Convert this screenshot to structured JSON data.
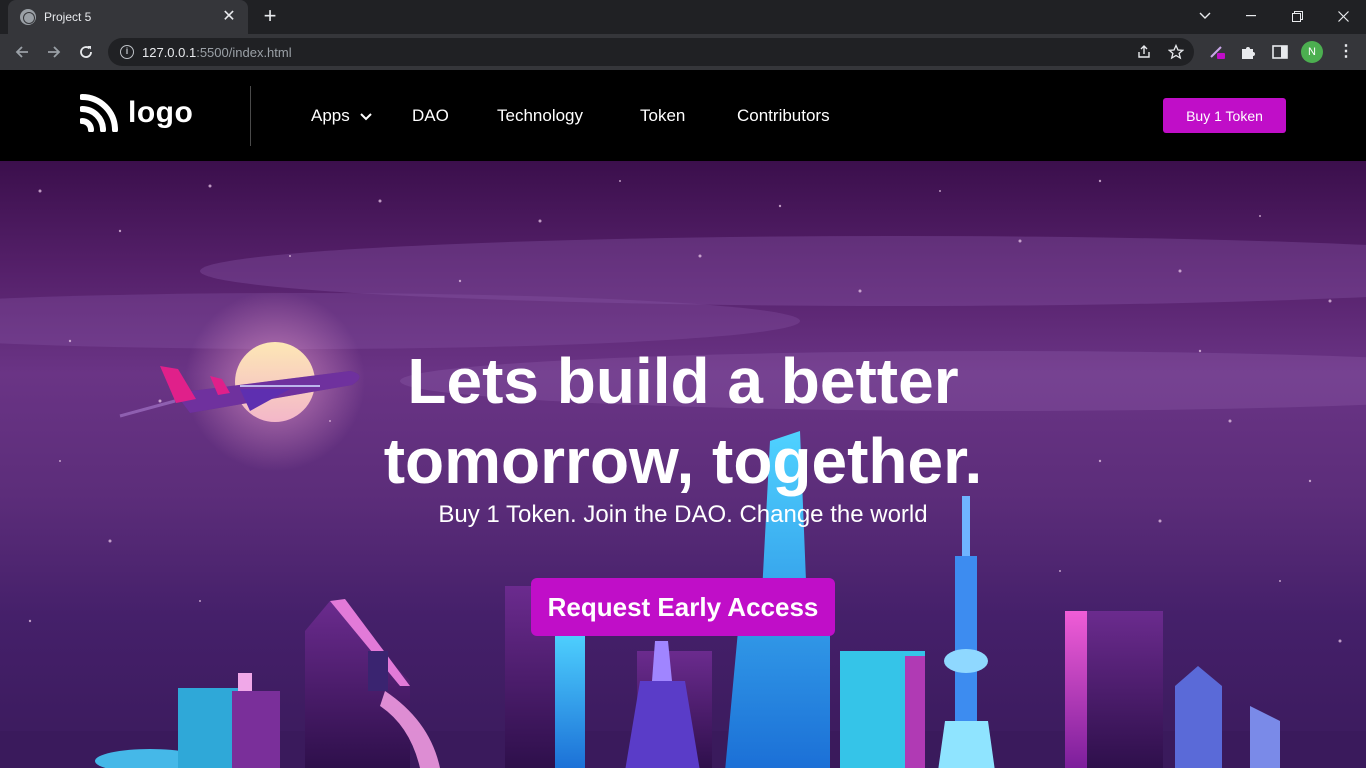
{
  "browser": {
    "tab_title": "Project 5",
    "url_host": "127.0.0.1",
    "url_path": ":5500/index.html",
    "profile_initial": "N"
  },
  "site": {
    "logo_text": "logo",
    "menu": [
      {
        "label": "Apps",
        "has_dropdown": true
      },
      {
        "label": "DAO"
      },
      {
        "label": "Technology"
      },
      {
        "label": "Token"
      },
      {
        "label": "Contributors"
      }
    ],
    "header_cta": "Buy 1 Token"
  },
  "hero": {
    "headline_line1": "Lets build a better",
    "headline_line2": "tomorrow, together.",
    "subheadline": "Buy 1 Token. Join the DAO. Change the world",
    "cta": "Request Early Access"
  },
  "colors": {
    "accent": "#c00ec8",
    "header_bg": "#000000"
  }
}
